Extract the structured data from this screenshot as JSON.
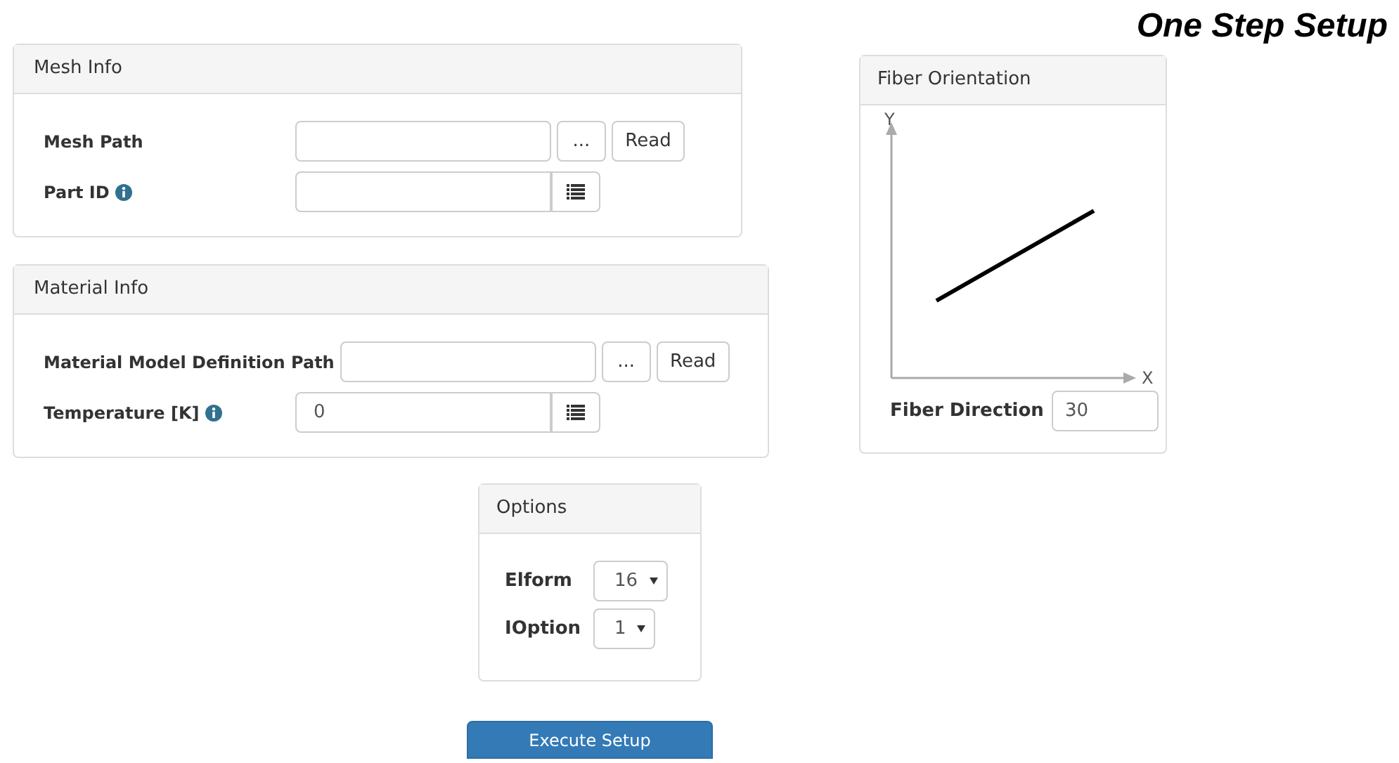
{
  "title": "One Step Setup",
  "mesh_info": {
    "title": "Mesh Info",
    "rows": [
      {
        "kind": "path",
        "label": "Mesh Path",
        "value": "",
        "browse": "...",
        "read": "Read"
      },
      {
        "kind": "list",
        "label": "Part ID",
        "info": true,
        "value": ""
      }
    ]
  },
  "material_info": {
    "title": "Material Info",
    "rows": [
      {
        "kind": "path",
        "label": "Material Model Definition Path",
        "value": "",
        "browse": "...",
        "read": "Read"
      },
      {
        "kind": "list",
        "label": "Temperature [K]",
        "info": true,
        "value": "0"
      }
    ]
  },
  "fiber_orientation": {
    "title": "Fiber Orientation",
    "x_axis": "X",
    "y_axis": "Y",
    "direction_label": "Fiber Direction",
    "direction_value": "30"
  },
  "options": {
    "title": "Options",
    "selects": [
      {
        "label": "Elform",
        "value": "16"
      },
      {
        "label": "IOption",
        "value": "1"
      }
    ]
  },
  "execute_button": "Execute Setup"
}
